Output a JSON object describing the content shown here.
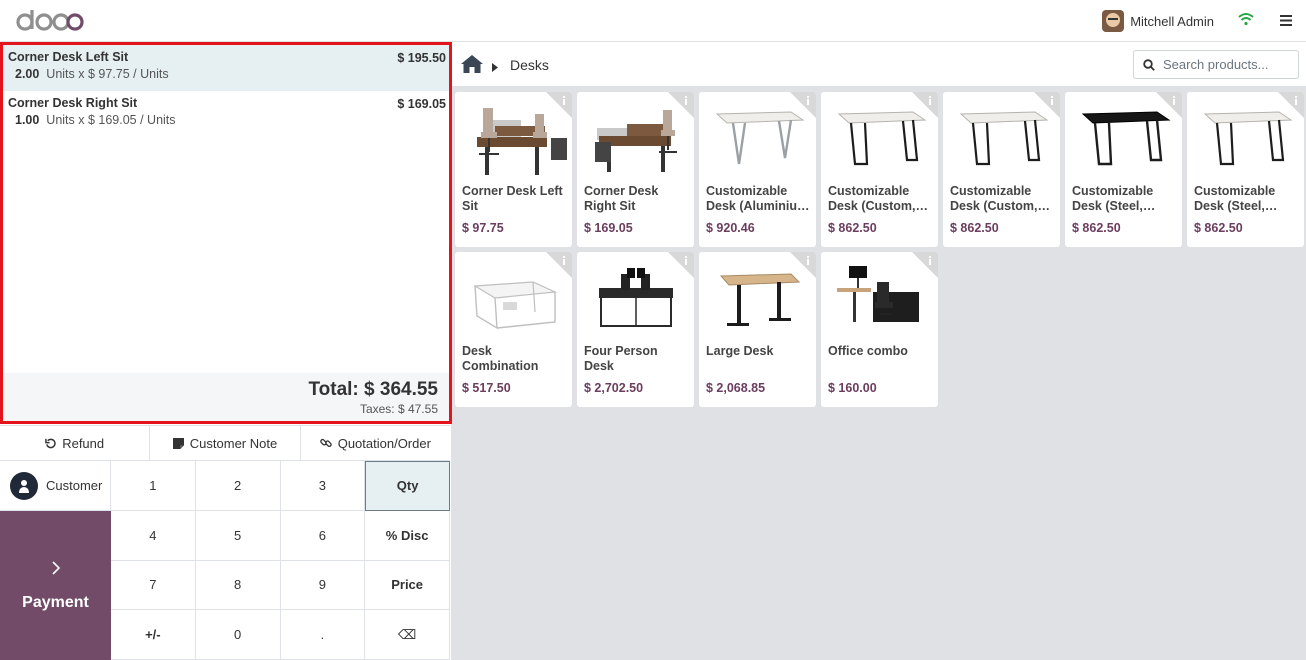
{
  "topbar": {
    "logo_text": "odoo",
    "user_name": "Mitchell Admin",
    "icons": [
      "wifi-icon",
      "hamburger-menu-icon"
    ]
  },
  "order": {
    "lines": [
      {
        "name": "Corner Desk Left Sit",
        "qty": "2.00",
        "unit_text": "Units x $ 97.75 / Units",
        "price": "$ 195.50"
      },
      {
        "name": "Corner Desk Right Sit",
        "qty": "1.00",
        "unit_text": "Units x $ 169.05 / Units",
        "price": "$ 169.05"
      }
    ],
    "total": "Total: $ 364.55",
    "taxes": "Taxes: $ 47.55"
  },
  "controls": {
    "refund": "Refund",
    "customer_note": "Customer Note",
    "quotation": "Quotation/Order"
  },
  "pad": {
    "customer": "Customer",
    "payment": "Payment",
    "keys": [
      "1",
      "2",
      "3",
      "Qty",
      "4",
      "5",
      "6",
      "% Disc",
      "7",
      "8",
      "9",
      "Price",
      "+/-",
      "0",
      ".",
      "⌫"
    ]
  },
  "breadcrumb": {
    "category": "Desks"
  },
  "search": {
    "placeholder": "Search products..."
  },
  "products": [
    {
      "name": "Corner Desk Left Sit",
      "price": "$ 97.75"
    },
    {
      "name": "Corner Desk Right Sit",
      "price": "$ 169.05"
    },
    {
      "name": "Customizable Desk (Aluminiu…",
      "price": "$ 920.46"
    },
    {
      "name": "Customizable Desk (Custom,…",
      "price": "$ 862.50"
    },
    {
      "name": "Customizable Desk (Custom,…",
      "price": "$ 862.50"
    },
    {
      "name": "Customizable Desk (Steel,…",
      "price": "$ 862.50"
    },
    {
      "name": "Customizable Desk (Steel,…",
      "price": "$ 862.50"
    },
    {
      "name": "Desk Combination",
      "price": "$ 517.50"
    },
    {
      "name": "Four Person Desk",
      "price": "$ 2,702.50"
    },
    {
      "name": "Large Desk",
      "price": "$ 2,068.85"
    },
    {
      "name": "Office combo",
      "price": "$ 160.00"
    }
  ]
}
